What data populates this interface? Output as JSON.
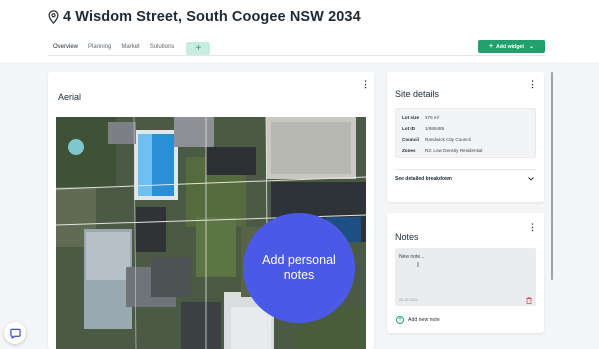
{
  "header": {
    "pin_icon": "location-pin-icon",
    "title": "4 Wisdom Street, South Coogee NSW 2034",
    "tabs": [
      {
        "label": "Overview",
        "active": true
      },
      {
        "label": "Planning",
        "active": false
      },
      {
        "label": "Market",
        "active": false
      },
      {
        "label": "Solutions",
        "active": false
      }
    ],
    "add_tab_label": "+",
    "add_widget": {
      "plus": "+",
      "label": "Add widget",
      "icon": "chevron-down-icon"
    }
  },
  "aerial": {
    "title": "Aerial",
    "menu_icon": "kebab-menu-icon",
    "overlay_label": "Add personal notes"
  },
  "site_details": {
    "title": "Site details",
    "menu_icon": "kebab-menu-icon",
    "rows": [
      {
        "key": "Lot size",
        "value": "376 m²"
      },
      {
        "key": "Lot ID",
        "value": "1/986485"
      },
      {
        "key": "Council",
        "value": "Randwick City Council"
      },
      {
        "key": "Zones",
        "value": "R2: Low Density Residential"
      }
    ],
    "see_more": "See detailed breakdown"
  },
  "notes": {
    "title": "Notes",
    "menu_icon": "kebab-menu-icon",
    "placeholder": "New note...",
    "date": "20.12.2021",
    "add_label": "Add new note"
  },
  "colors": {
    "accent": "#22a06b",
    "overlay": "#4a5ae6"
  },
  "chat_icon": "chat-bubble-icon"
}
